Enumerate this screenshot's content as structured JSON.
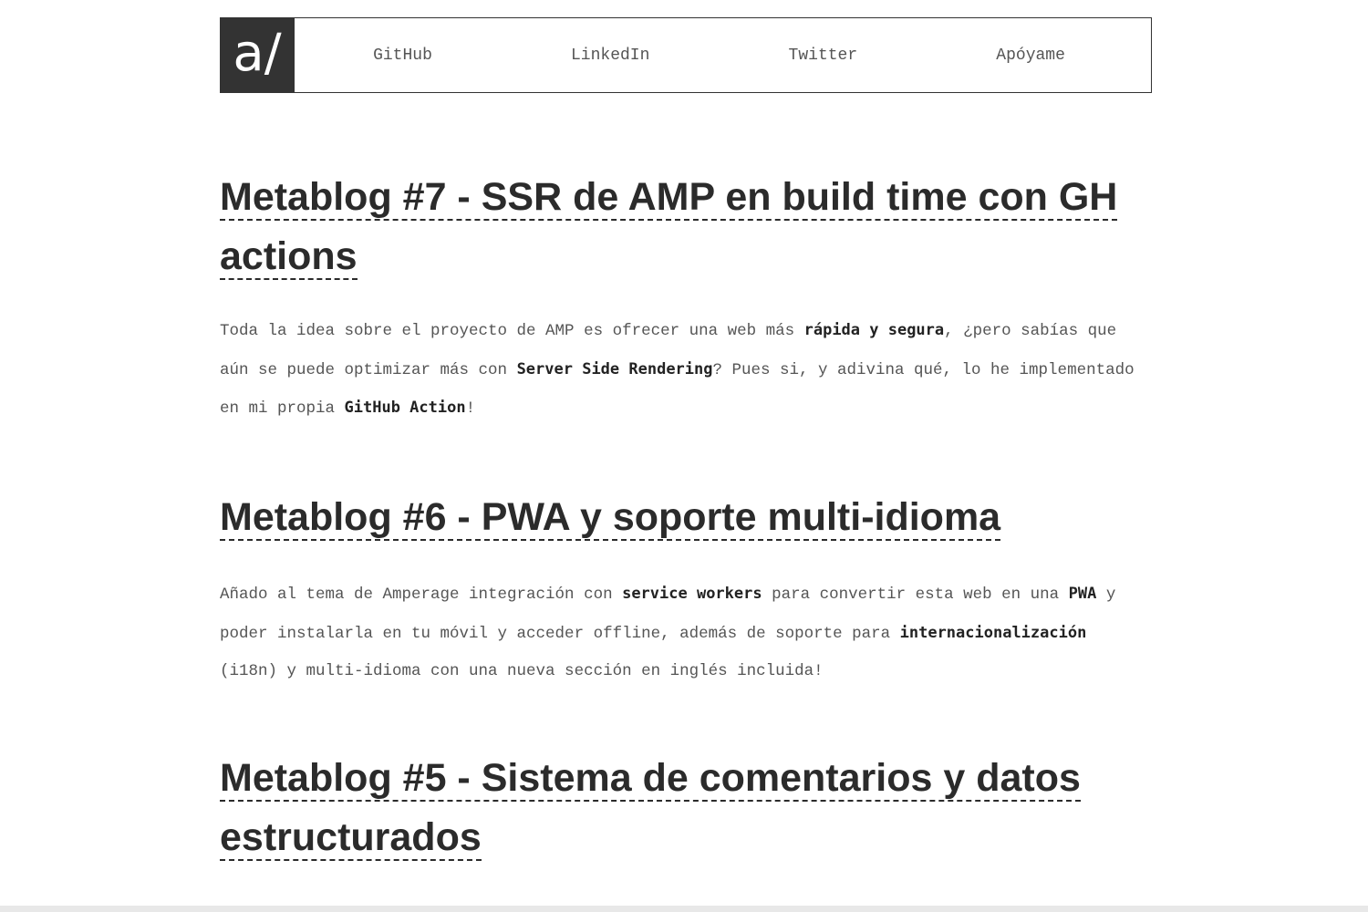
{
  "logo": {
    "text": "a/"
  },
  "nav": [
    {
      "label": "GitHub"
    },
    {
      "label": "LinkedIn"
    },
    {
      "label": "Twitter"
    },
    {
      "label": "Apóyame"
    }
  ],
  "posts": [
    {
      "title": "Metablog #7 - SSR de AMP en build time con GH actions",
      "summary": [
        {
          "t": "Toda la idea sobre el proyecto de AMP es ofrecer una web más "
        },
        {
          "b": "rápida y segura"
        },
        {
          "t": ", ¿pero sabías que aún se puede optimizar más con "
        },
        {
          "b": "Server Side Rendering"
        },
        {
          "t": "? Pues si, y adivina qué, lo he implementado en mi propia "
        },
        {
          "b": "GitHub Action"
        },
        {
          "t": "!"
        }
      ]
    },
    {
      "title": "Metablog #6 - PWA y soporte multi-idioma",
      "summary": [
        {
          "t": "Añado al tema de Amperage integración con "
        },
        {
          "b": "service workers"
        },
        {
          "t": " para convertir esta web en una "
        },
        {
          "b": "PWA"
        },
        {
          "t": " y poder instalarla en tu móvil y acceder offline, además de soporte para "
        },
        {
          "b": "internacionalización"
        },
        {
          "t": " (i18n) y multi-idioma con una nueva sección en inglés incluida!"
        }
      ]
    },
    {
      "title": "Metablog #5 - Sistema de comentarios y datos estructurados",
      "summary": []
    }
  ]
}
